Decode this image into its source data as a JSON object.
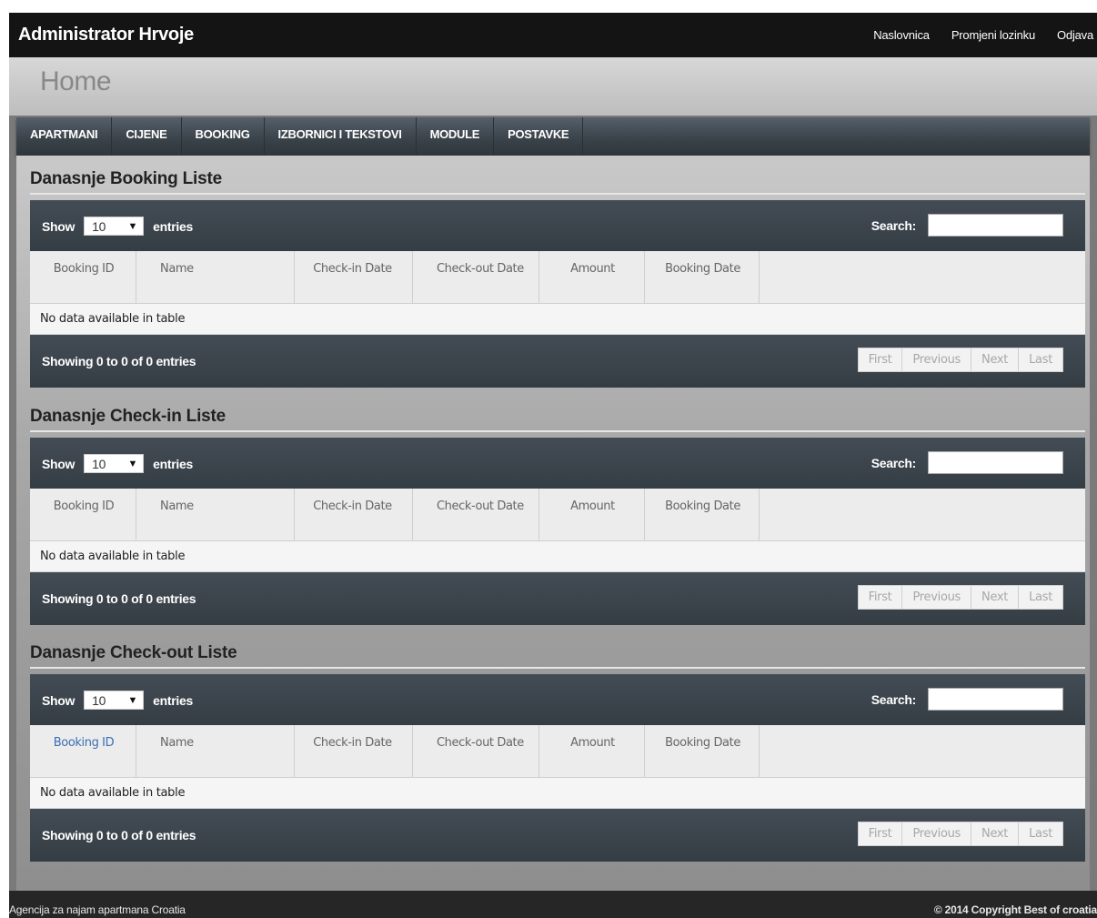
{
  "header": {
    "title": "Administrator Hrvoje",
    "links": [
      "Naslovnica",
      "Promjeni lozinku",
      "Odjava"
    ]
  },
  "page": {
    "title": "Home"
  },
  "nav": {
    "items": [
      "APARTMANI",
      "CIJENE",
      "BOOKING",
      "IZBORNICI I TEKSTOVI",
      "MODULE",
      "POSTAVKE"
    ]
  },
  "table": {
    "show_label": "Show",
    "entries_label": "entries",
    "page_size": "10",
    "search_label": "Search:",
    "columns": [
      "Booking ID",
      "Name",
      "Check-in Date",
      "Check-out Date",
      "Amount",
      "Booking Date"
    ],
    "empty_message": "No data available in table",
    "info": "Showing 0 to 0 of 0 entries",
    "pager": [
      "First",
      "Previous",
      "Next",
      "Last"
    ]
  },
  "sections": [
    {
      "title": "Danasnje Booking Liste"
    },
    {
      "title": "Danasnje Check-in Liste"
    },
    {
      "title": "Danasnje Check-out Liste"
    }
  ],
  "footer": {
    "left": "Agencija za najam apartmana Croatia",
    "right": "© 2014 Copyright Best of croatia"
  },
  "colors": {
    "topbar": "#141414",
    "nav": "#3b434b",
    "sorted_header": "#3a6fb4"
  }
}
